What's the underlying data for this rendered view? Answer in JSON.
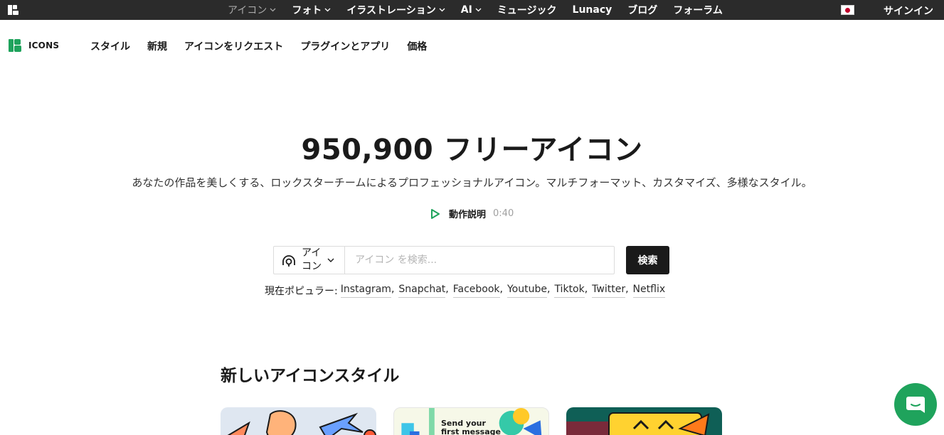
{
  "topbar": {
    "items": [
      {
        "label": "アイコン",
        "chevron": true,
        "active": true
      },
      {
        "label": "フォト",
        "chevron": true
      },
      {
        "label": "イラストレーション",
        "chevron": true
      },
      {
        "label": "AI",
        "chevron": true
      },
      {
        "label": "ミュージック",
        "chevron": false
      },
      {
        "label": "Lunacy",
        "chevron": false
      },
      {
        "label": "ブログ",
        "chevron": false
      },
      {
        "label": "フォーラム",
        "chevron": false
      }
    ],
    "signin": "サインイン"
  },
  "subnav": {
    "brand": "ICONS",
    "links": [
      "スタイル",
      "新規",
      "アイコンをリクエスト",
      "プラグインとアプリ",
      "価格"
    ]
  },
  "hero": {
    "title": "950,900 フリーアイコン",
    "subtitle": "あなたの作品を美しくする、ロックスターチームによるプロフェッショナルアイコン。マルチフォーマット、カスタマイズ、多様なスタイル。",
    "howto_label": "動作説明",
    "howto_duration": "0:40"
  },
  "search": {
    "type_label": "アイコン",
    "placeholder": "アイコン を検索...",
    "button": "検索"
  },
  "popular": {
    "label": "現在ポピュラー:",
    "tags": [
      "Instagram",
      "Snapchat",
      "Facebook",
      "Youtube",
      "Tiktok",
      "Twitter",
      "Netflix"
    ]
  },
  "section": {
    "title": "新しいアイコンスタイル",
    "card2_text_line1": "Send your",
    "card2_text_line2": "first message"
  },
  "colors": {
    "topbar_bg": "#2b2b2b",
    "brand_green": "#1fa35c",
    "button_bg": "#1a1a1a"
  }
}
